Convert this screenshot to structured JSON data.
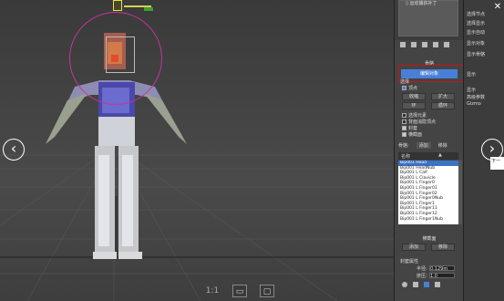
{
  "viewport": {
    "view_label": "1:1",
    "nav_prev_glyph": "‹",
    "nav_next_glyph": "›"
  },
  "panel": {
    "preview_label": "▯ 运动捕获补丁",
    "section_title": "骨骼",
    "select_button": "编辑对象",
    "selection_label": "选择",
    "vertex_label": "顶点",
    "shrink_label": "收缩",
    "grow_label": "扩大",
    "ring_label": "环",
    "loop_label": "循环",
    "options": [
      {
        "label": "选择元素",
        "checked": false
      },
      {
        "label": "背面消隐顶点",
        "checked": false
      },
      {
        "label": "封套",
        "checked": true
      },
      {
        "label": "横截面",
        "checked": true
      }
    ],
    "tabs": [
      "骨骼:",
      "添加",
      "移除"
    ],
    "list_header": "名称",
    "bones": [
      "Bip001 Head",
      "Bip001 HeadNub",
      "Bip001 L Calf",
      "Bip001 L Clavicle",
      "Bip001 L Finger0",
      "Bip001 L Finger01",
      "Bip001 L Finger02",
      "Bip001 L Finger0Nub",
      "Bip001 L Finger1",
      "Bip001 L Finger11",
      "Bip001 L Finger12",
      "Bip001 L Finger1Nub"
    ],
    "selected_bone_index": 0,
    "section_cross": "横截面",
    "cross_add": "添加",
    "cross_remove": "移除",
    "envelope_section": "封套属性",
    "radius_label": "半径:",
    "radius_value": "0.129m",
    "squash_label": "挤压:",
    "squash_value": "1.0"
  },
  "panel2": {
    "rows": [
      "选择节点",
      "选择显示",
      "显示自动",
      "显示对象",
      "显示骨骼",
      "显示"
    ],
    "item_a": "显示",
    "item_b": "高级参数",
    "item_c": "Gizmo",
    "tooltip": "下一"
  },
  "colors": {
    "accent": "#4a7fd8",
    "highlight_frame": "#c41616",
    "gizmo": "#c4359c"
  }
}
